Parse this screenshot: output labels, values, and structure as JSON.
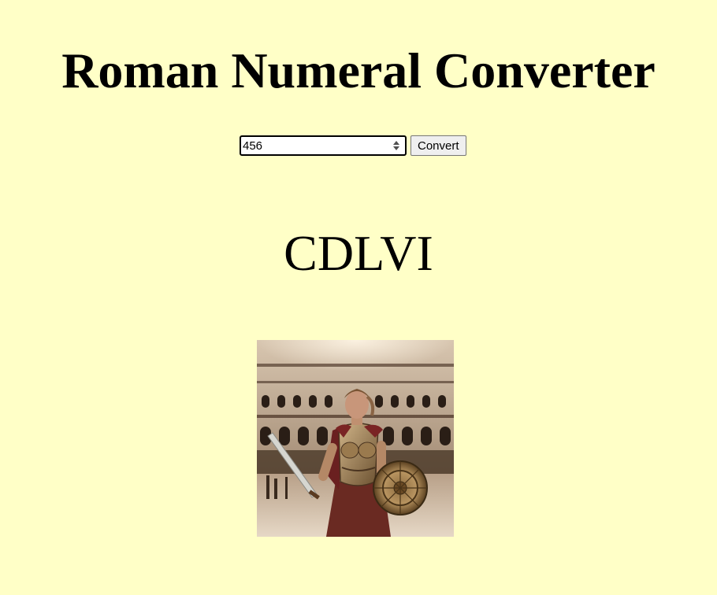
{
  "page": {
    "title": "Roman Numeral Converter",
    "background_color": "#ffffc7"
  },
  "form": {
    "number_input_value": "456",
    "convert_button_label": "Convert"
  },
  "result": {
    "roman_numeral": "CDLVI"
  },
  "image": {
    "subject": "female gladiator with sword and round shield in colosseum arena"
  }
}
